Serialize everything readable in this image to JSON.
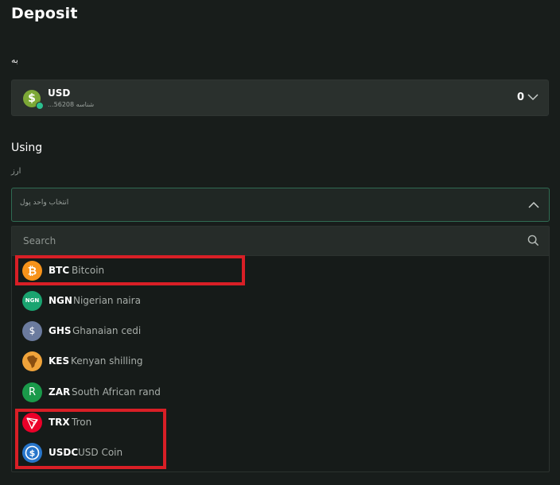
{
  "page": {
    "title": "Deposit",
    "to_label": "به"
  },
  "account": {
    "code": "USD",
    "subtitle": "شناسه 56208...",
    "balance": "0",
    "icon": "dollar-icon",
    "icon_color": "#7ca836"
  },
  "using": {
    "label": "Using",
    "currency_label": "ارز",
    "placeholder": "انتخاب واحد پول"
  },
  "search": {
    "placeholder": "Search"
  },
  "currencies": [
    {
      "code": "BTC",
      "name": "Bitcoin",
      "icon": "bitcoin-icon",
      "color": "#f7931a"
    },
    {
      "code": "NGN",
      "name": "Nigerian naira",
      "icon": "naira-icon",
      "color": "#1aa470",
      "icon_text": "NGN"
    },
    {
      "code": "GHS",
      "name": "Ghanaian cedi",
      "icon": "cedi-icon",
      "color": "#6b7b9e",
      "icon_text": "$"
    },
    {
      "code": "KES",
      "name": "Kenyan shilling",
      "icon": "africa-icon",
      "color": "#f0a33a"
    },
    {
      "code": "ZAR",
      "name": "South African rand",
      "icon": "rand-icon",
      "color": "#1a9a4a",
      "icon_text": "R"
    },
    {
      "code": "TRX",
      "name": "Tron",
      "icon": "tron-icon",
      "color": "#eb0029"
    },
    {
      "code": "USDC",
      "name": "USD Coin",
      "icon": "usdc-icon",
      "color": "#2775ca"
    }
  ],
  "colors": {
    "accent_border": "#2f6b52",
    "highlight": "#d91f26"
  }
}
